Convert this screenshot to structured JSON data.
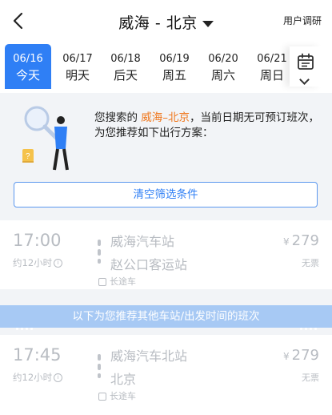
{
  "header": {
    "title": "威海 - 北京",
    "survey_label": "用户调研"
  },
  "dates": [
    {
      "md": "06/16",
      "wk": "今天",
      "active": true
    },
    {
      "md": "06/17",
      "wk": "明天",
      "active": false
    },
    {
      "md": "06/18",
      "wk": "后天",
      "active": false
    },
    {
      "md": "06/19",
      "wk": "周五",
      "active": false
    },
    {
      "md": "06/20",
      "wk": "周六",
      "active": false
    },
    {
      "md": "06/21",
      "wk": "周日",
      "active": false
    }
  ],
  "notice": {
    "prefix": "您搜索的 ",
    "route": "威海–北京",
    "suffix": "，当前日期无可预订班次，为您推荐如下出行方案：",
    "clear_button": "清空筛选条件"
  },
  "trips": [
    {
      "time": "17:00",
      "duration": "约12小时",
      "from": "威海汽车站",
      "to": "赵公口客运站",
      "type": "长途车",
      "currency": "¥",
      "price": "279",
      "status": "无票"
    }
  ],
  "recommend_banner": "以下为您推荐其他车站/出发时间的班次",
  "rec_trips": [
    {
      "time": "17:45",
      "duration": "约12小时",
      "from": "威海汽车北站",
      "to": "北京",
      "type": "长途车",
      "currency": "¥",
      "price": "279",
      "status": "无票"
    }
  ],
  "colors": {
    "accent": "#2f7ff5",
    "route_highlight": "#f0761b",
    "banner": "#a7c9f4",
    "disabled_text": "#b8bcc2"
  }
}
